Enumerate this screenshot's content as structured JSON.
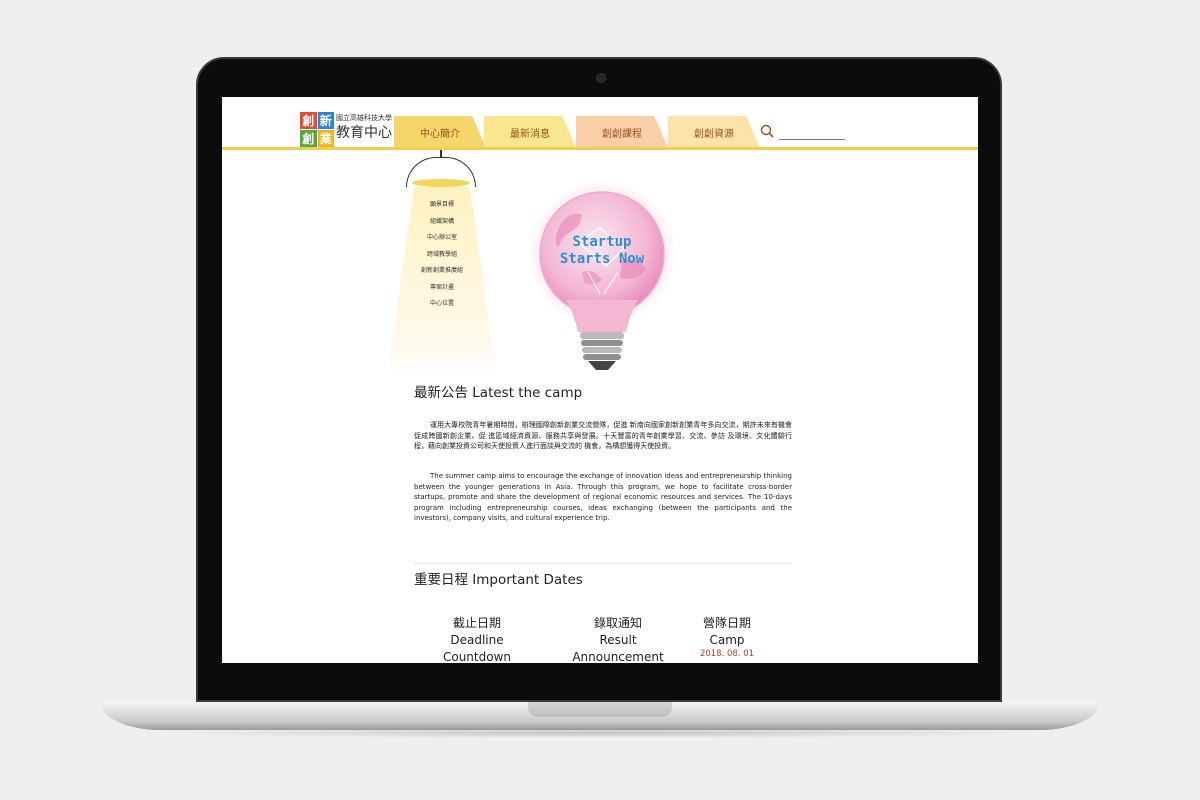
{
  "header": {
    "logo_chars": [
      "創",
      "新",
      "創",
      "業"
    ],
    "org_small": "國立高雄科技大學",
    "org_big": "教育中心"
  },
  "nav": {
    "tabs": [
      {
        "label": "中心簡介"
      },
      {
        "label": "最新消息"
      },
      {
        "label": "創創課程"
      },
      {
        "label": "創創資源"
      }
    ]
  },
  "side_menu": {
    "items": [
      "願景目標",
      "組織架構",
      "中心辦公室",
      "跨域教學組",
      "創新創業推廣組",
      "專案計畫",
      "中心位置"
    ]
  },
  "hero": {
    "line1": "Startup",
    "line2": "Starts Now"
  },
  "latest": {
    "title": "最新公告 Latest the camp",
    "para_zh": "運用大專校院青年暑期時間，辦理國際創新創業交流營隊，促進 新南向國家創新創業青年多向交流，期許未來有機會促成跨國新創企業、促 進區域經濟資源、服務共享與發展。十天豐富的青年創業學習、交流、參訪 及環境、文化體驗行程，藉向創業投資公司和天使投資人進行面談與交流的 機會，為構想獲得天使投資。",
    "para_en": "The summer camp aims to encourage the exchange of innovation ideas and entrepreneurship thinking between the younger generations in Asia. Through this program, we hope to facilitate cross-border startups, promote and share the development of regional economic resources and services. The 10-days program including entrepreneurship courses, ideas exchanging (between the participants and the investors), company visits, and cultural experience trip."
  },
  "dates": {
    "title": "重要日程 Important Dates",
    "columns": [
      {
        "zh": "截止日期",
        "en1": "Deadline",
        "en2": "Countdown",
        "value": ""
      },
      {
        "zh": "錄取通知",
        "en1": "Result",
        "en2": "Announcement",
        "value": ""
      },
      {
        "zh": "營隊日期",
        "en1": "Camp",
        "en2": "",
        "value": "2018. 08. 01"
      }
    ]
  },
  "colors": {
    "accent_yellow": "#f1cd52",
    "nav_text": "#a34c1c",
    "date_value": "#c0392b",
    "bulb_text": "#2d8fd6"
  }
}
